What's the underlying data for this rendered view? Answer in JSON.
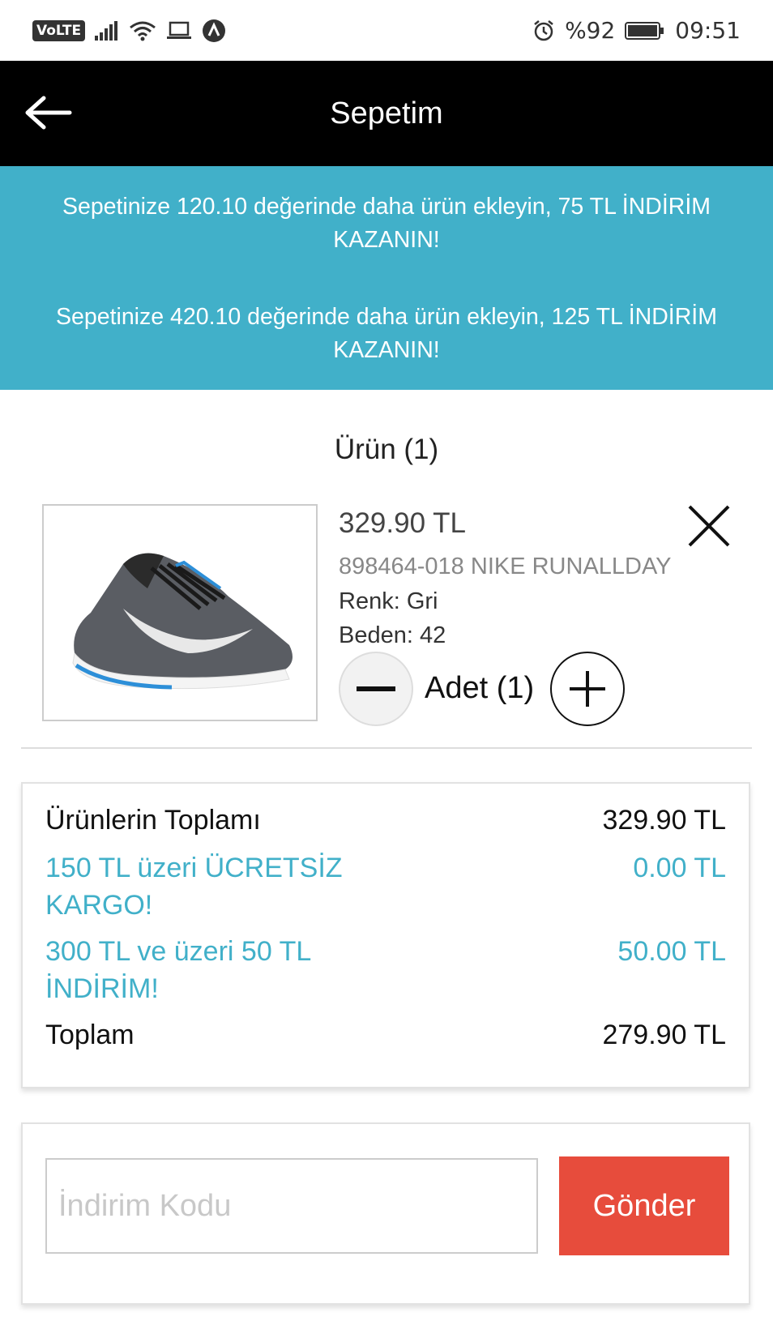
{
  "status_bar": {
    "volte": "VoLTE",
    "battery_text": "%92",
    "time": "09:51",
    "icons": [
      "volte-icon",
      "signal-icon",
      "wifi-icon",
      "laptop-icon",
      "nav-app-icon",
      "alarm-icon",
      "battery-icon"
    ]
  },
  "header": {
    "title": "Sepetim",
    "back_icon": "arrow-left-icon"
  },
  "promo": {
    "color": "#41b0c9",
    "messages": [
      "Sepetinize 120.10 değerinde daha ürün ekleyin,  75 TL İNDİRİM KAZANIN!",
      "Sepetinize 420.10 değerinde daha ürün ekleyin,  125 TL İNDİRİM KAZANIN!"
    ]
  },
  "cart": {
    "section_title": "Ürün (1)",
    "item": {
      "image": "running-shoe-image",
      "price": "329.90 TL",
      "name": "898464-018 NIKE RUNALLDAY",
      "color": "Renk: Gri",
      "size": "Beden: 42",
      "quantity_label": "Adet (1)",
      "quantity": 1,
      "remove_icon": "close-icon",
      "minus_icon": "minus-icon",
      "plus_icon": "plus-icon"
    }
  },
  "summary": {
    "rows": [
      {
        "label": "Ürünlerin Toplamı",
        "value": "329.90 TL",
        "style": "dark"
      },
      {
        "label": "150 TL üzeri ÜCRETSİZ KARGO!",
        "value": "0.00 TL",
        "style": "teal"
      },
      {
        "label": "300 TL ve üzeri 50 TL İNDİRİM!",
        "value": "50.00 TL",
        "style": "teal"
      },
      {
        "label": "Toplam",
        "value": "279.90 TL",
        "style": "dark"
      }
    ]
  },
  "coupon": {
    "placeholder": "İndirim Kodu",
    "value": "",
    "button_label": "Gönder",
    "button_color": "#e74c3c"
  }
}
